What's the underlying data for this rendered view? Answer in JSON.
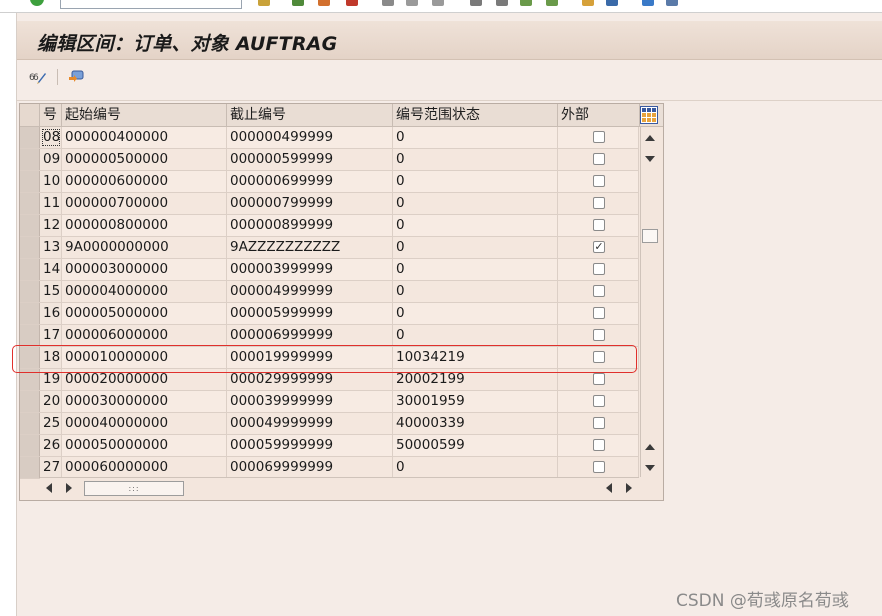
{
  "window": {
    "title": "编辑区间：订单、对象 AUFTRAG"
  },
  "toolbar": {
    "icons": [
      "change-mode-icon",
      "settings-icon"
    ]
  },
  "table": {
    "columns": [
      "号",
      "起始编号",
      "截止编号",
      "编号范围状态",
      "外部"
    ],
    "rows": [
      {
        "no": "08",
        "from": "000000400000",
        "to": "000000499999",
        "status": "0",
        "external": false
      },
      {
        "no": "09",
        "from": "000000500000",
        "to": "000000599999",
        "status": "0",
        "external": false
      },
      {
        "no": "10",
        "from": "000000600000",
        "to": "000000699999",
        "status": "0",
        "external": false
      },
      {
        "no": "11",
        "from": "000000700000",
        "to": "000000799999",
        "status": "0",
        "external": false
      },
      {
        "no": "12",
        "from": "000000800000",
        "to": "000000899999",
        "status": "0",
        "external": false
      },
      {
        "no": "13",
        "from": "9A0000000000",
        "to": "9AZZZZZZZZZZ",
        "status": "0",
        "external": true
      },
      {
        "no": "14",
        "from": "000003000000",
        "to": "000003999999",
        "status": "0",
        "external": false
      },
      {
        "no": "15",
        "from": "000004000000",
        "to": "000004999999",
        "status": "0",
        "external": false
      },
      {
        "no": "16",
        "from": "000005000000",
        "to": "000005999999",
        "status": "0",
        "external": false
      },
      {
        "no": "17",
        "from": "000006000000",
        "to": "000006999999",
        "status": "0",
        "external": false
      },
      {
        "no": "18",
        "from": "000010000000",
        "to": "000019999999",
        "status": "10034219",
        "external": false
      },
      {
        "no": "19",
        "from": "000020000000",
        "to": "000029999999",
        "status": "20002199",
        "external": false
      },
      {
        "no": "20",
        "from": "000030000000",
        "to": "000039999999",
        "status": "30001959",
        "external": false
      },
      {
        "no": "25",
        "from": "000040000000",
        "to": "000049999999",
        "status": "40000339",
        "external": false
      },
      {
        "no": "26",
        "from": "000050000000",
        "to": "000059999999",
        "status": "50000599",
        "external": false
      },
      {
        "no": "27",
        "from": "000060000000",
        "to": "000069999999",
        "status": "0",
        "external": false
      }
    ],
    "hscroll_thumb": ":::"
  },
  "watermark": "CSDN @荀彧原名荀彧",
  "colors": {
    "background": "#f5ece7",
    "highlight": "#e0302c"
  }
}
